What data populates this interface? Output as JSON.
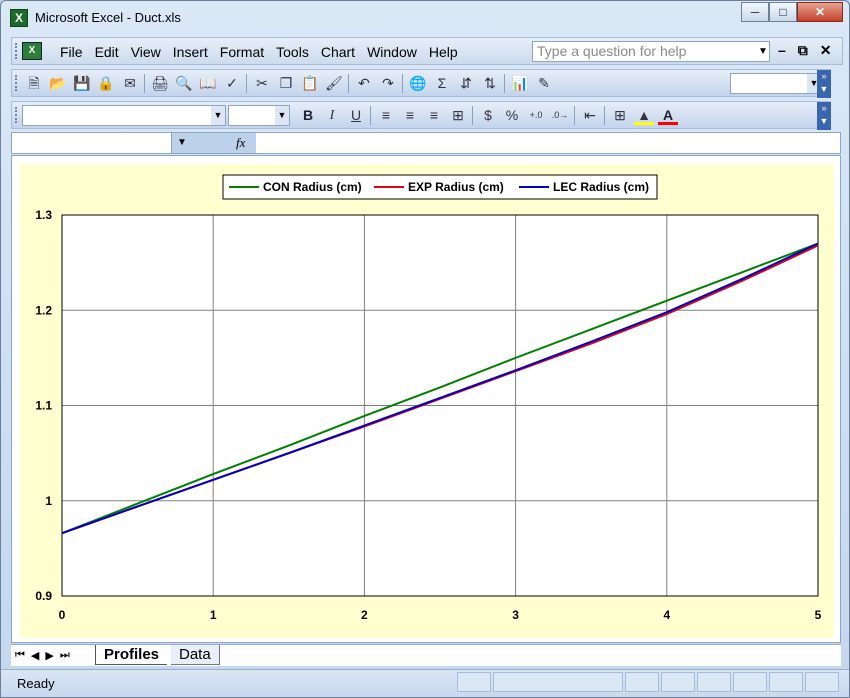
{
  "window": {
    "title": "Microsoft Excel - Duct.xls",
    "app_icon": "excel-icon"
  },
  "menubar": {
    "items": [
      "File",
      "Edit",
      "View",
      "Insert",
      "Format",
      "Tools",
      "Chart",
      "Window",
      "Help"
    ],
    "help_placeholder": "Type a question for help"
  },
  "toolbar_standard": {
    "icons": [
      "new-icon",
      "open-icon",
      "save-icon",
      "permission-icon",
      "email-icon",
      "print-icon",
      "print-preview-icon",
      "research-icon",
      "spelling-icon",
      "cut-icon",
      "copy-icon",
      "paste-icon",
      "format-painter-icon",
      "undo-icon",
      "redo-icon",
      "hyperlink-icon",
      "autosum-icon",
      "sort-ascending-icon",
      "sort-descending-icon",
      "chart-wizard-icon",
      "drawing-icon"
    ]
  },
  "toolbar_formatting": {
    "icons": [
      "bold-icon",
      "italic-icon",
      "underline-icon",
      "align-left-icon",
      "center-icon",
      "align-right-icon",
      "merge-center-icon",
      "currency-icon",
      "percent-icon",
      "increase-decimal-icon",
      "decrease-decimal-icon",
      "decrease-indent-icon",
      "borders-icon",
      "fill-color-icon",
      "font-color-icon"
    ],
    "labels": {
      "bold": "B",
      "italic": "I",
      "underline": "U",
      "currency": "$",
      "percent": "%",
      "font_color": "A"
    },
    "colors": {
      "fill": "#ffff00",
      "font": "#ff0000"
    }
  },
  "formula_bar": {
    "fx_label": "fx",
    "name_box": "",
    "formula": ""
  },
  "sheet_tabs": {
    "tabs": [
      "Profiles",
      "Data"
    ],
    "active": "Profiles"
  },
  "status_bar": {
    "text": "Ready"
  },
  "chart_data": {
    "type": "line",
    "title": "",
    "xlabel": "",
    "ylabel": "",
    "xlim": [
      0,
      5
    ],
    "ylim": [
      0.9,
      1.3
    ],
    "xticks": [
      "0",
      "1",
      "2",
      "3",
      "4",
      "5"
    ],
    "yticks": [
      "0.9",
      "1",
      "1.1",
      "1.2",
      "1.3"
    ],
    "grid": true,
    "legend": "top",
    "x": [
      0,
      0.5,
      1,
      1.5,
      2,
      2.5,
      3,
      3.5,
      4,
      4.5,
      5
    ],
    "series": [
      {
        "name": "CON Radius (cm)",
        "color": "#008000",
        "values": [
          0.966,
          0.997,
          1.028,
          1.058,
          1.089,
          1.119,
          1.15,
          1.18,
          1.21,
          1.24,
          1.27
        ]
      },
      {
        "name": "EXP Radius (cm)",
        "color": "#e0001b",
        "values": [
          0.966,
          0.994,
          1.022,
          1.05,
          1.078,
          1.107,
          1.136,
          1.165,
          1.196,
          1.231,
          1.268
        ]
      },
      {
        "name": "LEC Radius (cm)",
        "color": "#0000c0",
        "values": [
          0.966,
          0.994,
          1.022,
          1.05,
          1.079,
          1.108,
          1.137,
          1.167,
          1.198,
          1.233,
          1.27
        ]
      }
    ]
  }
}
